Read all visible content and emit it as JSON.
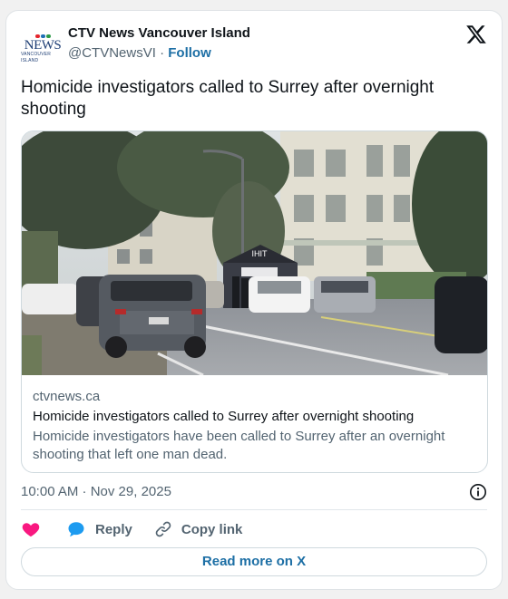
{
  "author": {
    "name": "CTV News Vancouver Island",
    "handle": "@CTVNewsVI",
    "separator": "·",
    "follow_label": "Follow",
    "avatar_logo": "NEWS",
    "avatar_sub": "VANCOUVER ISLAND"
  },
  "tweet": {
    "text": "Homicide investigators called to Surrey after overnight shooting"
  },
  "link_card": {
    "domain": "ctvnews.ca",
    "title": "Homicide investigators called to Surrey after overnight shooting",
    "description": "Homicide investigators have been called to Surrey after an overnight shooting that left one man dead.",
    "tent_text": "IHIT"
  },
  "meta": {
    "timestamp": "10:00 AM · Nov 29, 2025"
  },
  "actions": {
    "reply_label": "Reply",
    "copy_link_label": "Copy link"
  },
  "footer": {
    "read_more_label": "Read more on X"
  },
  "icons": {
    "platform": "x-logo-icon",
    "like": "heart-icon",
    "reply": "speech-bubble-icon",
    "copy": "link-icon",
    "info": "info-icon"
  },
  "colors": {
    "accent": "#1d6fa5",
    "heart": "#f91880",
    "reply": "#1d9bf0",
    "muted": "#536471"
  }
}
